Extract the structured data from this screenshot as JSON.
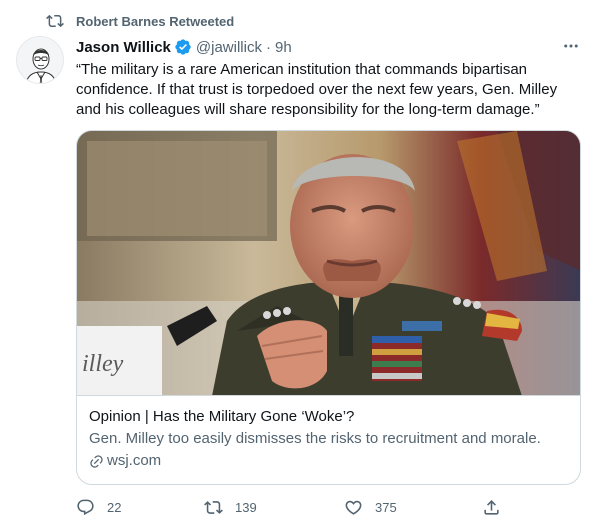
{
  "retweet": {
    "text": "Robert Barnes Retweeted",
    "icon": "retweet-icon"
  },
  "author": {
    "name": "Jason Willick",
    "verified": true,
    "handle": "@jawillick",
    "time": "9h",
    "avatar": "illustrated-portrait"
  },
  "tweet": {
    "text": "“The military is a rare American institution that commands bipartisan confidence. If that trust is torpedoed over the next few years, Gen. Milley and his colleagues will share responsibility for the long-term damage.”"
  },
  "card": {
    "title": "Opinion | Has the Military Gone ‘Woke’?",
    "description": "Gen. Milley too easily dismisses the risks to recruitment and morale.",
    "domain": "wsj.com",
    "nameplate_text": "illey"
  },
  "actions": {
    "replies": "22",
    "retweets": "139",
    "likes": "375"
  },
  "colors": {
    "text": "#0f1419",
    "secondary": "#536471",
    "border": "#cfd9de",
    "verified": "#1d9bf0"
  }
}
